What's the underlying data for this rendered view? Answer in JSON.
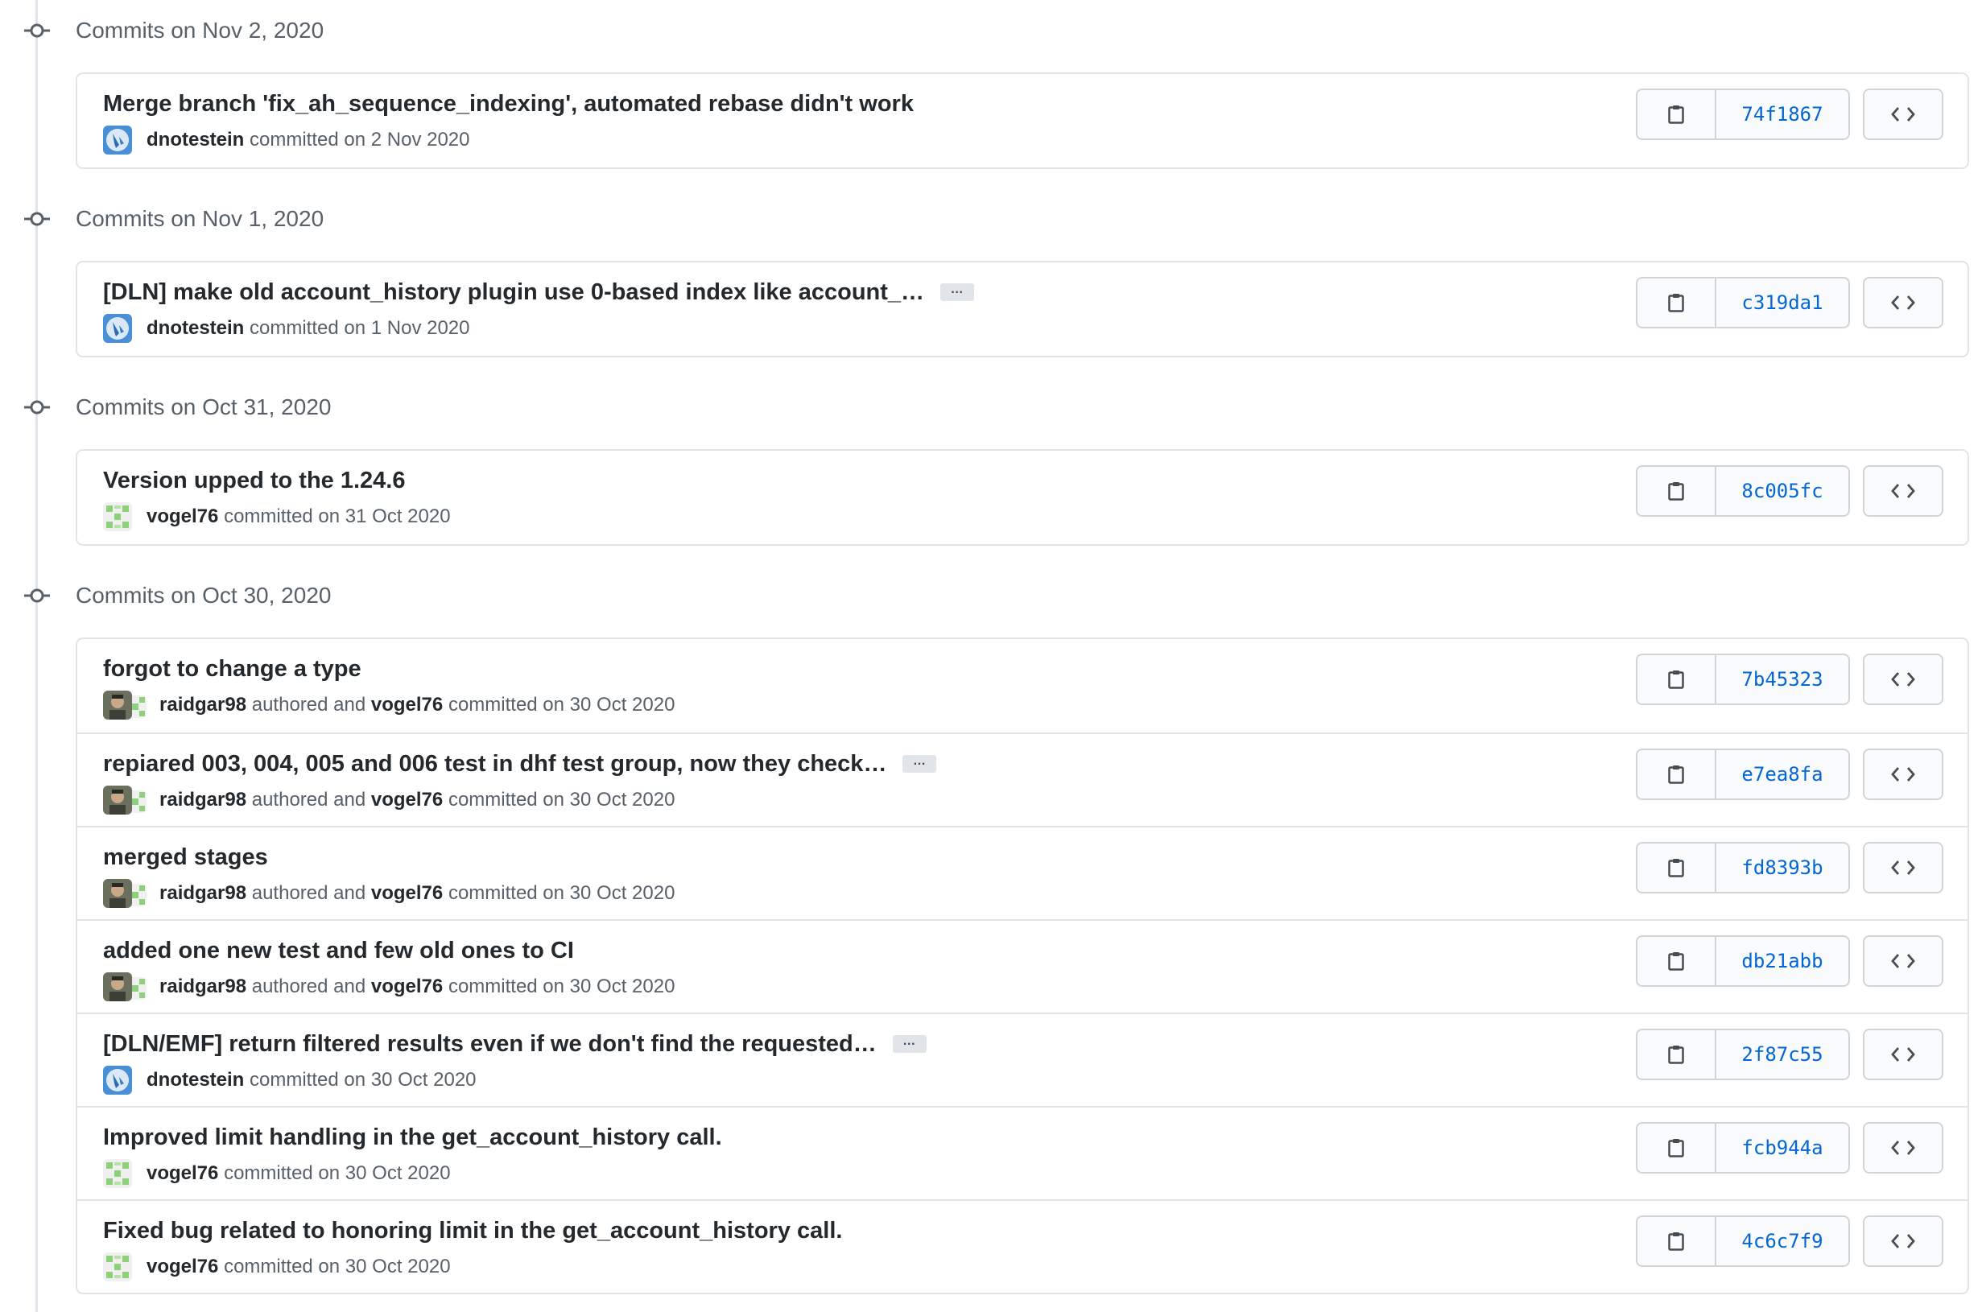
{
  "groups": [
    {
      "title": "Commits on Nov 2, 2020",
      "commits": [
        {
          "message": "Merge branch 'fix_ah_sequence_indexing', automated rebase didn't work",
          "truncated": false,
          "committer": "dnotestein",
          "verb": "committed on",
          "date": "2 Nov 2020",
          "sha": "74f1867"
        }
      ]
    },
    {
      "title": "Commits on Nov 1, 2020",
      "commits": [
        {
          "message": "[DLN] make old account_history plugin use 0-based index like account_…",
          "truncated": true,
          "committer": "dnotestein",
          "verb": "committed on",
          "date": "1 Nov 2020",
          "sha": "c319da1"
        }
      ]
    },
    {
      "title": "Commits on Oct 31, 2020",
      "commits": [
        {
          "message": "Version upped to the 1.24.6",
          "truncated": false,
          "committer": "vogel76",
          "verb": "committed on",
          "date": "31 Oct 2020",
          "sha": "8c005fc"
        }
      ]
    },
    {
      "title": "Commits on Oct 30, 2020",
      "commits": [
        {
          "message": "forgot to change a type",
          "truncated": false,
          "author": "raidgar98",
          "authored_text": "authored and",
          "committer": "vogel76",
          "verb": "committed on",
          "date": "30 Oct 2020",
          "sha": "7b45323"
        },
        {
          "message": "repiared 003, 004, 005 and 006 test in dhf test group, now they check…",
          "truncated": true,
          "author": "raidgar98",
          "authored_text": "authored and",
          "committer": "vogel76",
          "verb": "committed on",
          "date": "30 Oct 2020",
          "sha": "e7ea8fa"
        },
        {
          "message": "merged stages",
          "truncated": false,
          "author": "raidgar98",
          "authored_text": "authored and",
          "committer": "vogel76",
          "verb": "committed on",
          "date": "30 Oct 2020",
          "sha": "fd8393b"
        },
        {
          "message": "added one new test and few old ones to CI",
          "truncated": false,
          "author": "raidgar98",
          "authored_text": "authored and",
          "committer": "vogel76",
          "verb": "committed on",
          "date": "30 Oct 2020",
          "sha": "db21abb"
        },
        {
          "message": "[DLN/EMF] return filtered results even if we don't find the requested…",
          "truncated": true,
          "committer": "dnotestein",
          "verb": "committed on",
          "date": "30 Oct 2020",
          "sha": "2f87c55"
        },
        {
          "message": "Improved limit handling in the get_account_history call.",
          "truncated": false,
          "committer": "vogel76",
          "verb": "committed on",
          "date": "30 Oct 2020",
          "sha": "fcb944a"
        },
        {
          "message": "Fixed bug related to honoring limit in the get_account_history call.",
          "truncated": false,
          "committer": "vogel76",
          "verb": "committed on",
          "date": "30 Oct 2020",
          "sha": "4c6c7f9"
        }
      ]
    }
  ],
  "ellipsis_label": "…",
  "icons": {
    "copy": "clipboard-icon",
    "browse": "code-brackets-icon",
    "timeline": "git-commit-icon"
  },
  "colors": {
    "sha_link": "#0366d6",
    "border": "#e1e4e8",
    "muted_text": "#586069"
  }
}
